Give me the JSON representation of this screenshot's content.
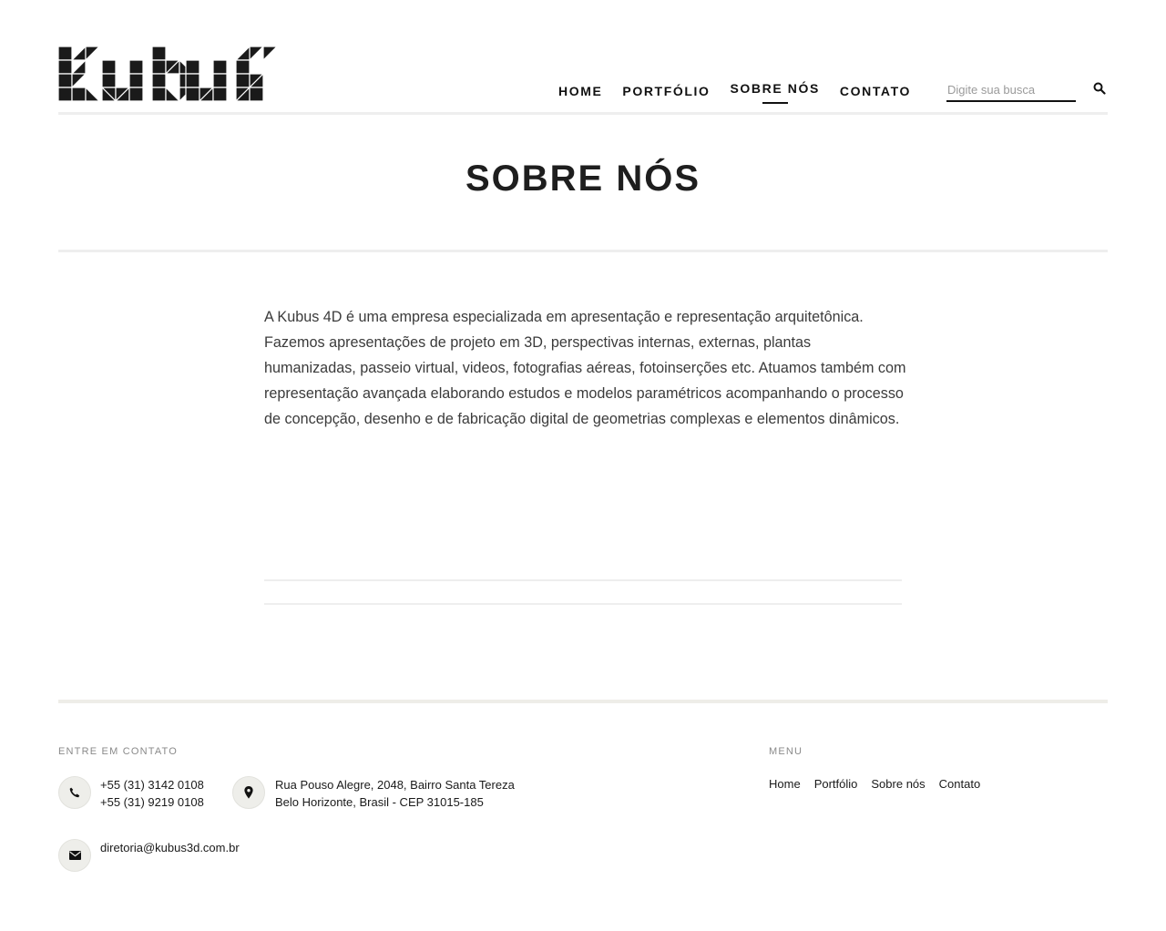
{
  "header": {
    "logo_alt": "Kubus",
    "nav": [
      {
        "label": "HOME"
      },
      {
        "label": "PORTFÓLIO"
      },
      {
        "label": "SOBRE NÓS"
      },
      {
        "label": "CONTATO"
      }
    ],
    "active_index": 2,
    "search": {
      "placeholder": "Digite sua busca",
      "value": ""
    }
  },
  "main": {
    "title": "SOBRE NÓS",
    "intro": "A Kubus 4D é uma empresa especializada em apresentação e representação arquitetônica. Fazemos apresentações de projeto em 3D, perspectivas internas, externas, plantas humanizadas, passeio virtual, videos, fotografias aéreas, fotoinserções etc. Atuamos também com representação avançada elaborando estudos e modelos paramétricos acompanhando o processo de concepção, desenho e de fabricação digital de geometrias complexas e elementos dinâmicos."
  },
  "footer": {
    "contact_heading": "ENTRE EM CONTATO",
    "phones": [
      "+55 (31) 3142 0108",
      "+55 (31) 9219 0108"
    ],
    "address": [
      "Rua Pouso Alegre, 2048, Bairro Santa Tereza",
      "Belo Horizonte, Brasil - CEP 31015-185"
    ],
    "email": "diretoria@kubus3d.com.br",
    "menu_heading": "MENU",
    "menu": [
      {
        "label": "Home"
      },
      {
        "label": "Portfólio"
      },
      {
        "label": "Sobre nós"
      },
      {
        "label": "Contato"
      }
    ]
  },
  "colors": {
    "text": "#2b2b2b",
    "heading": "#1e1e1e",
    "rule": "#eeeeee",
    "icon_circle": "#eeeeea"
  },
  "icons": [
    "search-icon",
    "phone-icon",
    "map-pin-icon",
    "envelope-icon"
  ]
}
